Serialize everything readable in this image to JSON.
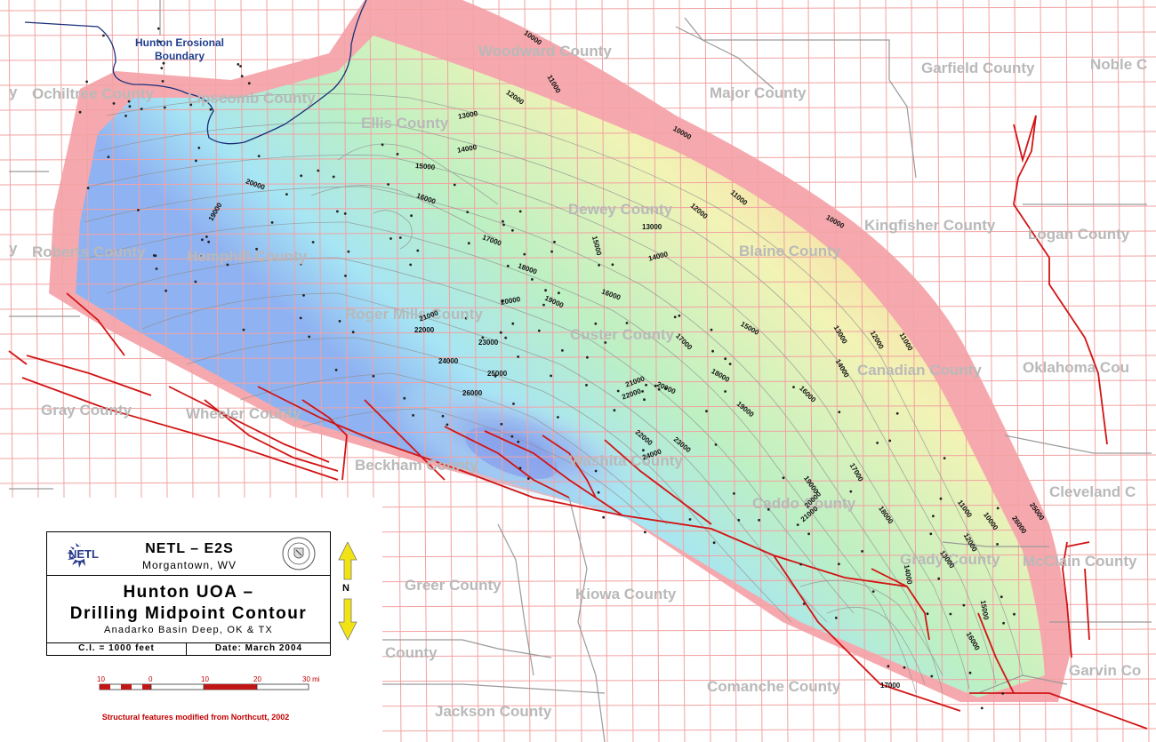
{
  "map": {
    "erosion_label": "Hunton Erosional\nBoundary",
    "counties": [
      {
        "text": "Woodward County"
      },
      {
        "text": "Garfield County"
      },
      {
        "text": "Noble C"
      },
      {
        "text": "Major County"
      },
      {
        "text": "y"
      },
      {
        "text": "Ochiltree County"
      },
      {
        "text": "Lipscomb County"
      },
      {
        "text": "Ellis County"
      },
      {
        "text": "Dewey County"
      },
      {
        "text": "Kingfisher County"
      },
      {
        "text": "Logan County"
      },
      {
        "text": "y"
      },
      {
        "text": "Roberts County"
      },
      {
        "text": "Hemphill County"
      },
      {
        "text": "Blaine County"
      },
      {
        "text": "Roger Mills County"
      },
      {
        "text": "Custer County"
      },
      {
        "text": "Canadian County"
      },
      {
        "text": "Oklahoma Cou"
      },
      {
        "text": "Gray County"
      },
      {
        "text": "Wheeler County"
      },
      {
        "text": "Beckham County"
      },
      {
        "text": "Washita County"
      },
      {
        "text": "Cleveland C"
      },
      {
        "text": "Caddo County"
      },
      {
        "text": "Grady County"
      },
      {
        "text": "McClain County"
      },
      {
        "text": "Greer County"
      },
      {
        "text": "Kiowa County"
      },
      {
        "text": "County"
      },
      {
        "text": "Comanche County"
      },
      {
        "text": "Garvin Co"
      },
      {
        "text": "Jackson County"
      }
    ],
    "contour_labels": [
      "10000",
      "11000",
      "12000",
      "13000",
      "14000",
      "15000",
      "16000",
      "17000",
      "18000",
      "19000",
      "20000",
      "21000",
      "22000",
      "23000",
      "24000",
      "25000",
      "26000",
      "10000",
      "11000",
      "12000",
      "13000",
      "14000",
      "15000",
      "16000",
      "17000",
      "18000",
      "19000",
      "20000",
      "21000",
      "22000",
      "10000",
      "11000",
      "12000",
      "13000",
      "14000",
      "15000",
      "16000",
      "17000",
      "18000",
      "19000",
      "20000",
      "21000",
      "22000",
      "23000",
      "24000",
      "25000",
      "26000",
      "10000",
      "11000",
      "12000",
      "13000",
      "14000",
      "15000",
      "16000",
      "17000",
      "18000",
      "19000",
      "20000"
    ]
  },
  "legend": {
    "logo_text": "NETL",
    "org": "NETL – E2S",
    "city": "Morgantown, WV",
    "title_line1": "Hunton UOA –",
    "title_line2": "Drilling Midpoint Contour",
    "subtitle": "Anadarko Basin Deep, OK & TX",
    "ci": "C.I. = 1000 feet",
    "date": "Date:  March 2004",
    "north": "N",
    "scale_labels": [
      "10",
      "0",
      "10",
      "20",
      "30 mi"
    ],
    "credit": "Structural features modified from Northcutt, 2002"
  },
  "colors": {
    "deep": "#8fa8ef",
    "shallow": "#f59aa0",
    "fault": "#d21414",
    "grid": "#f19a9a",
    "county_line": "#9a9a9a",
    "erosion_line": "#1a2f7a"
  }
}
